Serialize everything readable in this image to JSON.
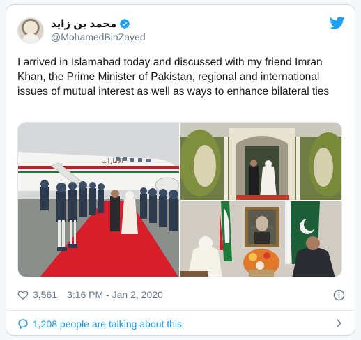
{
  "user": {
    "display_name": "محمد بن زايد",
    "handle": "@MohamedBinZayed",
    "verified": true
  },
  "tweet": {
    "text": "I arrived in Islamabad today and discussed with my friend Imran Khan, the Prime Minister of Pakistan, regional and international issues of mutual interest as well as ways to enhance bilateral ties"
  },
  "media": {
    "photos": [
      {
        "caption": "arrival-ceremony-red-carpet"
      },
      {
        "caption": "leaders-walking-through-doorway"
      },
      {
        "caption": "leaders-seated-meeting-with-flags"
      }
    ],
    "plane_livery": "الامارات"
  },
  "meta": {
    "likes": "3,561",
    "timestamp": "3:16 PM - Jan 2, 2020"
  },
  "conversation": {
    "label": "1,208 people are talking about this"
  },
  "colors": {
    "accent": "#1b95e0",
    "twitter_blue": "#1da1f2",
    "muted": "#657786",
    "border": "#e1e8ed"
  },
  "icons": [
    "verified-icon",
    "twitter-logo-icon",
    "heart-icon",
    "info-icon",
    "comment-icon",
    "chevron-right-icon"
  ]
}
